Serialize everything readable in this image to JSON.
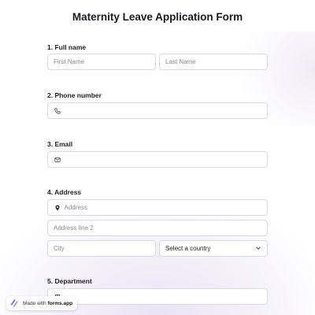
{
  "form": {
    "title": "Maternity Leave Application Form"
  },
  "questions": {
    "full_name": {
      "label": "1.  Full name",
      "first_placeholder": "First Name",
      "last_placeholder": "Last Name"
    },
    "phone": {
      "label": "2. Phone number",
      "icon": "phone-icon"
    },
    "email": {
      "label": "3. Email",
      "icon": "envelope-icon"
    },
    "address": {
      "label": "4. Address",
      "address_placeholder": "Address",
      "address2_placeholder": "Address line 2",
      "city_placeholder": "City",
      "country_selected": "Select a country",
      "icon": "map-pin-icon"
    },
    "department": {
      "label": "5. Department",
      "icon": "text-icon"
    }
  },
  "badge": {
    "prefix": "Made with",
    "brand": "forms.app"
  },
  "colors": {
    "accent": "#6b57d6",
    "border": "#d9d9df"
  }
}
